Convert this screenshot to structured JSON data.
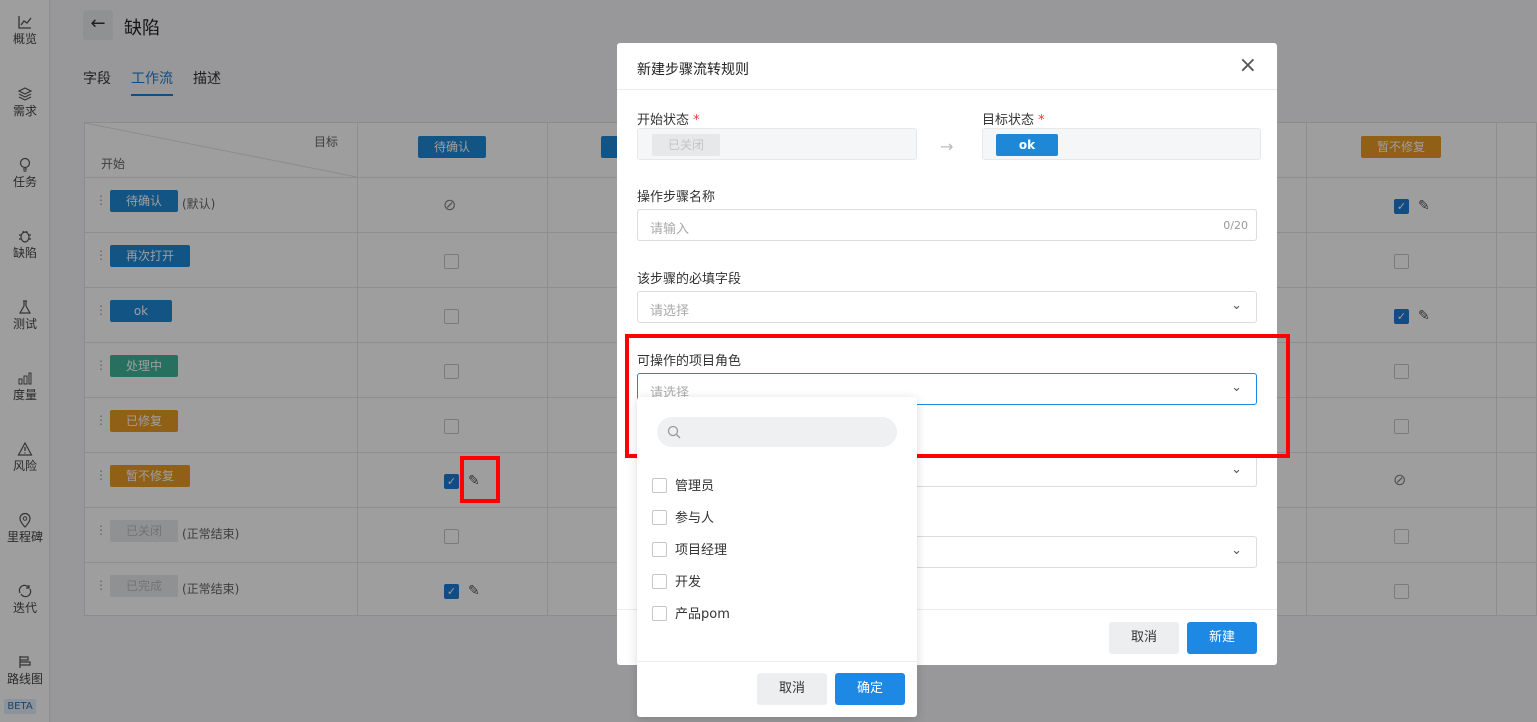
{
  "sidebar": {
    "items": [
      {
        "label": "概览",
        "icon": "chart-line-icon"
      },
      {
        "label": "需求",
        "icon": "layers-icon"
      },
      {
        "label": "任务",
        "icon": "lightbulb-icon"
      },
      {
        "label": "缺陷",
        "icon": "bug-icon"
      },
      {
        "label": "测试",
        "icon": "flask-icon"
      },
      {
        "label": "度量",
        "icon": "bar-chart-icon"
      },
      {
        "label": "风险",
        "icon": "warning-icon"
      },
      {
        "label": "里程碑",
        "icon": "location-pin-icon"
      },
      {
        "label": "迭代",
        "icon": "cycle-icon"
      },
      {
        "label": "路线图",
        "icon": "roadmap-icon"
      }
    ],
    "beta": "BETA"
  },
  "page": {
    "title": "缺陷",
    "tabs": [
      "字段",
      "工作流",
      "描述"
    ],
    "active_tab": "工作流"
  },
  "table": {
    "corner_target": "目标",
    "corner_start": "开始",
    "col_headers": [
      "待确认",
      "暂不修复"
    ],
    "rows": [
      {
        "status": "待确认",
        "note": "(默认)"
      },
      {
        "status": "再次打开",
        "note": ""
      },
      {
        "status": "ok",
        "note": ""
      },
      {
        "status": "处理中",
        "note": ""
      },
      {
        "status": "已修复",
        "note": ""
      },
      {
        "status": "暂不修复",
        "note": ""
      },
      {
        "status": "已关闭",
        "note": "(正常结束)"
      },
      {
        "status": "已完成",
        "note": "(正常结束)"
      }
    ]
  },
  "modal": {
    "title": "新建步骤流转规则",
    "start_label": "开始状态",
    "start_value": "已关闭",
    "target_label": "目标状态",
    "target_value": "ok",
    "required_mark": "*",
    "step_name_label": "操作步骤名称",
    "step_name_placeholder": "请输入",
    "step_name_count": "0/20",
    "required_fields_label": "该步骤的必填字段",
    "required_fields_placeholder": "请选择",
    "roles_label": "可操作的项目角色",
    "roles_placeholder": "请选择",
    "cancel": "取消",
    "create": "新建"
  },
  "dropdown": {
    "options": [
      "管理员",
      "参与人",
      "项目经理",
      "开发",
      "产品pom"
    ],
    "cancel": "取消",
    "confirm": "确定"
  }
}
